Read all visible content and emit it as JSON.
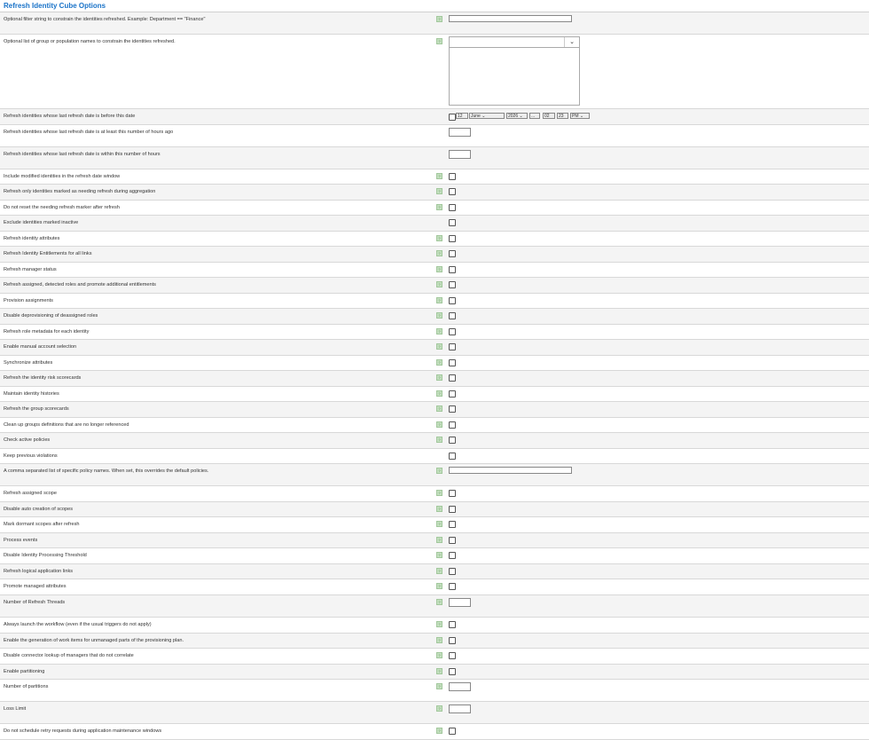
{
  "title": "Refresh Identity Cube Options",
  "help_glyph": "?",
  "date_picker": {
    "day": "12",
    "month": "June",
    "year": "2026",
    "dots": "...",
    "hour": "02",
    "minute": "23",
    "ampm": "PM"
  },
  "select_arrow": "⌄",
  "rows": [
    {
      "label": "Optional filter string to constrain the identities refreshed. Example: Department == \"Finance\"",
      "help": true,
      "control": "text-long",
      "h": 25
    },
    {
      "label": "Optional list of group or population names to constrain the identities refreshed.",
      "help": true,
      "control": "multiselect",
      "h": 84
    },
    {
      "label": "Refresh identities whose last refresh date is before this date",
      "help": false,
      "control": "date",
      "h": 18
    },
    {
      "label": "Refresh identities whose last refresh date is at least this number of hours ago",
      "help": false,
      "control": "text-short",
      "h": 25
    },
    {
      "label": "Refresh identities whose last refresh date is within this number of hours",
      "help": false,
      "control": "text-short",
      "h": 25
    },
    {
      "label": "Include modified identities in the refresh date window",
      "help": true,
      "control": "checkbox",
      "h": 17
    },
    {
      "label": "Refresh only identities marked as needing refresh during aggregation",
      "help": true,
      "control": "checkbox",
      "h": 18
    },
    {
      "label": "Do not reset the needing refresh marker after refresh",
      "help": true,
      "control": "checkbox",
      "h": 17
    },
    {
      "label": "Exclude identities marked inactive",
      "help": false,
      "control": "checkbox",
      "h": 18
    },
    {
      "label": "Refresh identity attributes",
      "help": true,
      "control": "checkbox",
      "h": 17
    },
    {
      "label": "Refresh Identity Entitlements for all links",
      "help": true,
      "control": "checkbox",
      "h": 18
    },
    {
      "label": "Refresh manager status",
      "help": true,
      "control": "checkbox",
      "h": 17
    },
    {
      "label": "Refresh assigned, detected roles and promote additional entitlements",
      "help": true,
      "control": "checkbox",
      "h": 18
    },
    {
      "label": "Provision assignments",
      "help": true,
      "control": "checkbox",
      "h": 17
    },
    {
      "label": "Disable deprovisioning of deassigned roles",
      "help": true,
      "control": "checkbox",
      "h": 18
    },
    {
      "label": "Refresh role metadata for each identity",
      "help": true,
      "control": "checkbox",
      "h": 17
    },
    {
      "label": "Enable manual account selection",
      "help": true,
      "control": "checkbox",
      "h": 18
    },
    {
      "label": "Synchronize attributes",
      "help": true,
      "control": "checkbox",
      "h": 17
    },
    {
      "label": "Refresh the identity risk scorecards",
      "help": true,
      "control": "checkbox",
      "h": 18
    },
    {
      "label": "Maintain identity histories",
      "help": true,
      "control": "checkbox",
      "h": 17
    },
    {
      "label": "Refresh the group scorecards",
      "help": true,
      "control": "checkbox",
      "h": 18
    },
    {
      "label": "Clean up groups definitions that are no longer referenced",
      "help": true,
      "control": "checkbox",
      "h": 17
    },
    {
      "label": "Check active policies",
      "help": true,
      "control": "checkbox",
      "h": 18
    },
    {
      "label": "Keep previous violations",
      "help": false,
      "control": "checkbox",
      "h": 17
    },
    {
      "label": "A comma separated list of specific policy names. When set, this overrides the default policies.",
      "help": true,
      "control": "text-long",
      "h": 25
    },
    {
      "label": "Refresh assigned scope",
      "help": true,
      "control": "checkbox",
      "h": 18
    },
    {
      "label": "Disable auto creation of scopes",
      "help": true,
      "control": "checkbox",
      "h": 17
    },
    {
      "label": "Mark dormant scopes after refresh",
      "help": true,
      "control": "checkbox",
      "h": 18
    },
    {
      "label": "Process events",
      "help": true,
      "control": "checkbox",
      "h": 17
    },
    {
      "label": "Disable Identity Processing Threshold",
      "help": true,
      "control": "checkbox",
      "h": 18
    },
    {
      "label": "Refresh logical application links",
      "help": true,
      "control": "checkbox",
      "h": 17
    },
    {
      "label": "Promote managed attributes",
      "help": true,
      "control": "checkbox",
      "h": 18
    },
    {
      "label": "Number of Refresh Threads",
      "help": true,
      "control": "text-short",
      "h": 25
    },
    {
      "label": "Always launch the workflow (even if the usual triggers do not apply)",
      "help": true,
      "control": "checkbox",
      "h": 18
    },
    {
      "label": "Enable the generation of work items for unmanaged parts of the provisioning plan.",
      "help": true,
      "control": "checkbox",
      "h": 17
    },
    {
      "label": "Disable connector lookup of managers that do not correlate",
      "help": true,
      "control": "checkbox",
      "h": 18
    },
    {
      "label": "Enable partitioning",
      "help": true,
      "control": "checkbox",
      "h": 17
    },
    {
      "label": "Number of partitions",
      "help": true,
      "control": "text-short",
      "h": 25
    },
    {
      "label": "Loss Limit",
      "help": true,
      "control": "text-short",
      "h": 25
    },
    {
      "label": "Do not schedule retry requests during application maintenance windows",
      "help": true,
      "control": "checkbox",
      "h": 18
    }
  ]
}
